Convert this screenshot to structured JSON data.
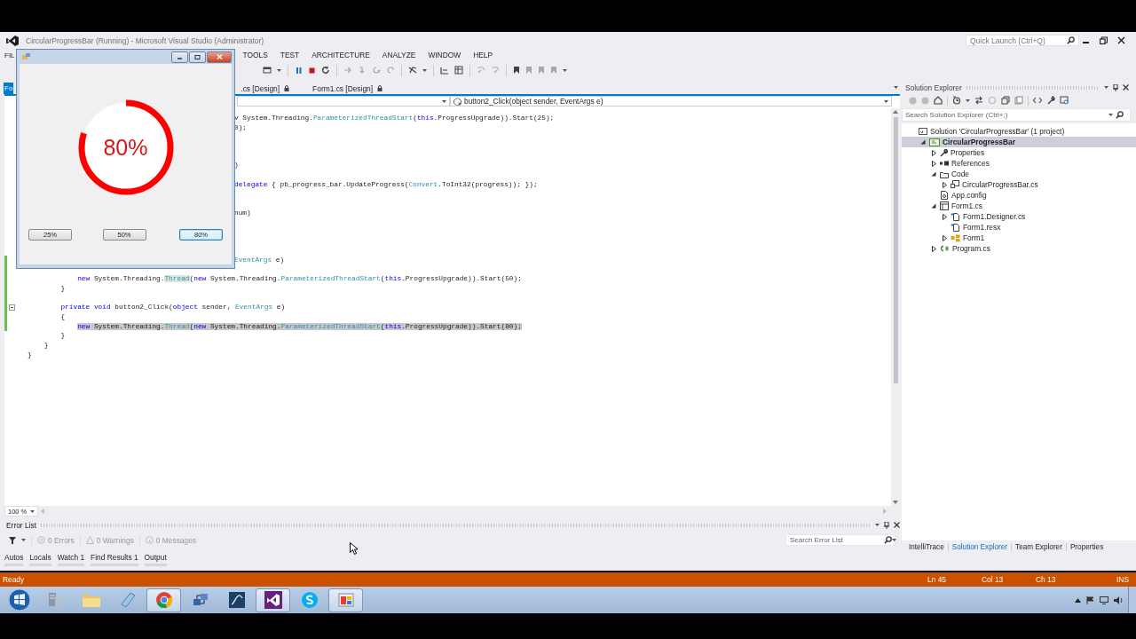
{
  "window": {
    "title": "CircularProgressBar (Running) - Microsoft Visual Studio (Administrator)"
  },
  "quick_launch": {
    "placeholder": "Quick Launch (Ctrl+Q)"
  },
  "menu": [
    {
      "label": "FIL"
    },
    {
      "label": "TOOLS"
    },
    {
      "label": "TEST"
    },
    {
      "label": "ARCHITECTURE"
    },
    {
      "label": "ANALYZE"
    },
    {
      "label": "WINDOW"
    },
    {
      "label": "HELP"
    }
  ],
  "document_tabs": [
    {
      "label": "Fo",
      "selected": true
    },
    {
      "label": ".cs [Design]",
      "selected": false
    },
    {
      "label": "Form1.cs [Design]",
      "selected": false
    }
  ],
  "navigation": {
    "member": "button2_Click(object sender, EventArgs e)"
  },
  "code_lines": [
    {
      "kind": "clipped",
      "changed": false,
      "selected": false,
      "tokens": [
        {
          "text": "v System.Threading.",
          "kind": "plain"
        },
        {
          "text": "ParameterizedThreadStart",
          "kind": "type"
        },
        {
          "text": "(",
          "kind": "plain"
        },
        {
          "text": "this",
          "kind": "keyword"
        },
        {
          "text": ".ProgressUpgrade)).Start(25);",
          "kind": "plain"
        }
      ]
    },
    {
      "kind": "clipped",
      "changed": false,
      "selected": false,
      "tokens": [
        {
          "text": "0);",
          "kind": "plain"
        }
      ]
    },
    {
      "kind": "code",
      "changed": false,
      "selected": false
    },
    {
      "kind": "code",
      "changed": false,
      "selected": false
    },
    {
      "kind": "code",
      "changed": false,
      "selected": false
    },
    {
      "kind": "clipped",
      "changed": false,
      "selected": false,
      "tokens": [
        {
          "text": ")",
          "kind": "plain"
        }
      ]
    },
    {
      "kind": "code",
      "changed": false,
      "selected": false
    },
    {
      "kind": "clipped",
      "changed": false,
      "selected": false,
      "tokens": [
        {
          "text": "delegate",
          "kind": "keyword"
        },
        {
          "text": " { pb_progress_bar.UpdateProgress(",
          "kind": "plain"
        },
        {
          "text": "Convert",
          "kind": "type"
        },
        {
          "text": ".ToInt32(progress)); });",
          "kind": "plain"
        }
      ]
    },
    {
      "kind": "code",
      "changed": false,
      "selected": false
    },
    {
      "kind": "code",
      "changed": false,
      "selected": false
    },
    {
      "kind": "clipped",
      "changed": false,
      "selected": false,
      "tokens": [
        {
          "text": "num)",
          "kind": "plain"
        }
      ]
    },
    {
      "kind": "code",
      "changed": false,
      "selected": false
    },
    {
      "kind": "code",
      "changed": false,
      "selected": false
    },
    {
      "kind": "code",
      "changed": false,
      "selected": false
    },
    {
      "kind": "code",
      "changed": false,
      "selected": false
    },
    {
      "kind": "clipped",
      "changed": true,
      "selected": false,
      "tokens": [
        {
          "text": "EventArgs",
          "kind": "type"
        },
        {
          "text": " e)",
          "kind": "plain"
        }
      ]
    },
    {
      "kind": "code",
      "changed": true,
      "selected": false
    },
    {
      "kind": "code",
      "changed": true,
      "selected": false,
      "tokens": [
        {
          "text": "            new",
          "kind": "keyword"
        },
        {
          "text": " System.Threading.",
          "kind": "plain"
        },
        {
          "text": "Thread",
          "kind": "ref"
        },
        {
          "text": "(",
          "kind": "plain"
        },
        {
          "text": "new",
          "kind": "keyword"
        },
        {
          "text": " System.Threading.",
          "kind": "plain"
        },
        {
          "text": "ParameterizedThreadStart",
          "kind": "type"
        },
        {
          "text": "(",
          "kind": "plain"
        },
        {
          "text": "this",
          "kind": "keyword"
        },
        {
          "text": ".ProgressUpgrade)).Start(50);",
          "kind": "plain"
        }
      ]
    },
    {
      "kind": "code",
      "changed": true,
      "selected": false,
      "tokens": [
        {
          "text": "        }",
          "kind": "plain"
        }
      ]
    },
    {
      "kind": "code",
      "changed": true,
      "selected": false
    },
    {
      "kind": "fold",
      "changed": true,
      "selected": false,
      "tokens": [
        {
          "text": "        private",
          "kind": "keyword"
        },
        {
          "text": " void",
          "kind": "keyword"
        },
        {
          "text": " button2_Click(",
          "kind": "plain"
        },
        {
          "text": "object",
          "kind": "keyword"
        },
        {
          "text": " sender, ",
          "kind": "plain"
        },
        {
          "text": "EventArgs",
          "kind": "type"
        },
        {
          "text": " e)",
          "kind": "plain"
        }
      ]
    },
    {
      "kind": "code",
      "changed": true,
      "selected": false,
      "tokens": [
        {
          "text": "        {",
          "kind": "plain"
        }
      ]
    },
    {
      "kind": "code",
      "changed": true,
      "selected": true,
      "tokens": [
        {
          "text": "            new",
          "kind": "keyword"
        },
        {
          "text": " System.Threading.",
          "kind": "plain"
        },
        {
          "text": "Thread",
          "kind": "ref"
        },
        {
          "text": "(",
          "kind": "plain"
        },
        {
          "text": "new",
          "kind": "keyword"
        },
        {
          "text": " System.Threading.",
          "kind": "plain"
        },
        {
          "text": "ParameterizedThreadStart",
          "kind": "type"
        },
        {
          "text": "(",
          "kind": "plain"
        },
        {
          "text": "this",
          "kind": "keyword"
        },
        {
          "text": ".ProgressUpgrade)).Start(80);",
          "kind": "plain"
        }
      ]
    },
    {
      "kind": "code",
      "changed": false,
      "selected": false,
      "tokens": [
        {
          "text": "        }",
          "kind": "plain"
        }
      ]
    },
    {
      "kind": "code",
      "changed": false,
      "selected": false,
      "tokens": [
        {
          "text": "    }",
          "kind": "plain"
        }
      ]
    },
    {
      "kind": "code",
      "changed": false,
      "selected": false,
      "tokens": [
        {
          "text": "}",
          "kind": "plain"
        }
      ]
    }
  ],
  "zoom": "100 %",
  "running_form": {
    "progress": {
      "reading": "80%"
    },
    "buttons": [
      {
        "label": "25%",
        "focused": false
      },
      {
        "label": "50%",
        "focused": false
      },
      {
        "label": "80%",
        "focused": true
      }
    ]
  },
  "error_list": {
    "title": "Error List",
    "filters": [
      {
        "kind": "error",
        "label": "0 Errors"
      },
      {
        "kind": "warning",
        "label": "0 Warnings"
      },
      {
        "kind": "message",
        "label": "0 Messages"
      }
    ],
    "search": {
      "placeholder": "Search Error List"
    }
  },
  "bottom_tabs": [
    {
      "label": "Autos"
    },
    {
      "label": "Locals"
    },
    {
      "label": "Watch 1"
    },
    {
      "label": "Find Results 1"
    },
    {
      "label": "Output"
    }
  ],
  "solution_explorer": {
    "title": "Solution Explorer",
    "search": {
      "placeholder": "Search Solution Explorer (Ctrl+;)"
    },
    "tree": [
      {
        "label": "Solution 'CircularProgressBar' (1 project)",
        "kind": "solution",
        "expandable": false,
        "selected": false,
        "children": [
          {
            "label": "CircularProgressBar",
            "kind": "project",
            "expandable": true,
            "expanded": true,
            "selected": true,
            "children": [
              {
                "label": "Properties",
                "kind": "properties",
                "expandable": true,
                "expanded": false,
                "selected": false
              },
              {
                "label": "References",
                "kind": "references",
                "expandable": true,
                "expanded": false,
                "selected": false
              },
              {
                "label": "Code",
                "kind": "folder",
                "expandable": true,
                "expanded": true,
                "selected": false,
                "children": [
                  {
                    "label": "CircularProgressBar.cs",
                    "kind": "component",
                    "expandable": true,
                    "expanded": false,
                    "selected": false
                  }
                ]
              },
              {
                "label": "App.config",
                "kind": "config",
                "expandable": false,
                "selected": false
              },
              {
                "label": "Form1.cs",
                "kind": "form",
                "expandable": true,
                "expanded": true,
                "selected": false,
                "children": [
                  {
                    "label": "Form1.Designer.cs",
                    "kind": "file",
                    "expandable": true,
                    "expanded": false,
                    "selected": false
                  },
                  {
                    "label": "Form1.resx",
                    "kind": "file",
                    "expandable": false,
                    "selected": false
                  },
                  {
                    "label": "Form1",
                    "kind": "class",
                    "expandable": true,
                    "expanded": false,
                    "selected": false
                  }
                ]
              },
              {
                "label": "Program.cs",
                "kind": "csharp",
                "expandable": true,
                "expanded": false,
                "selected": false
              }
            ]
          }
        ]
      }
    ]
  },
  "side_tabs": [
    {
      "label": "IntelliTrace",
      "selected": false
    },
    {
      "label": "Solution Explorer",
      "selected": true
    },
    {
      "label": "Team Explorer",
      "selected": false
    },
    {
      "label": "Properties",
      "selected": false
    }
  ],
  "status_bar": {
    "message": "Ready",
    "line": "Ln 45",
    "column": "Col 13",
    "char": "Ch 13",
    "mode": "INS"
  },
  "taskbar": {
    "items": [
      {
        "kind": "server",
        "active": false
      },
      {
        "kind": "folder",
        "active": false
      },
      {
        "kind": "notepad",
        "active": false
      },
      {
        "kind": "browser",
        "active": true
      },
      {
        "kind": "network",
        "active": false
      },
      {
        "kind": "database",
        "active": false
      },
      {
        "kind": "studio",
        "active": true
      },
      {
        "kind": "chat",
        "active": false
      },
      {
        "kind": "app",
        "active": true
      }
    ]
  }
}
